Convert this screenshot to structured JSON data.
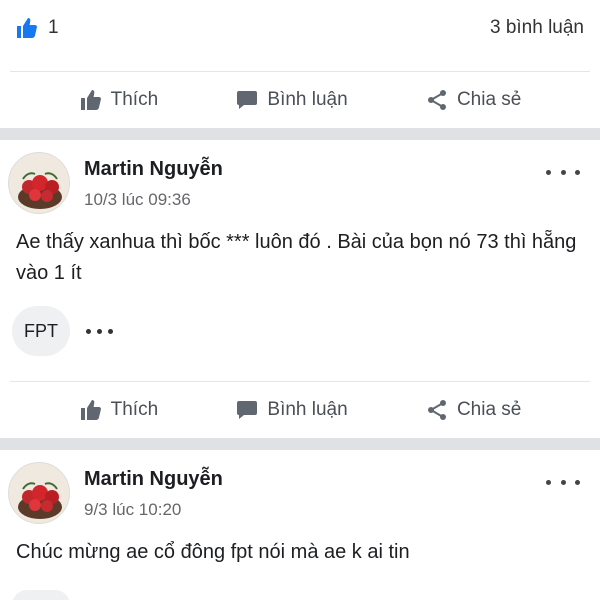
{
  "summary": {
    "reaction_count": "1",
    "comment_count": "3 bình luận"
  },
  "actions": {
    "like": "Thích",
    "comment": "Bình luận",
    "share": "Chia sẻ"
  },
  "posts": [
    {
      "author": "Martin Nguyễn",
      "timestamp": "10/3 lúc 09:36",
      "text": "Ae thấy xanhua thì bốc *** luôn đó . Bài của bọn nó 73 thì hẵng vào 1 ít",
      "tag": "FPT"
    },
    {
      "author": "Martin Nguyễn",
      "timestamp": "9/3 lúc 10:20",
      "text": "Chúc mừng ae cổ đông fpt nói mà ae k ai tin"
    }
  ],
  "colors": {
    "like_blue": "#1877f2",
    "separator_gray": "#dfe1e4",
    "secondary_text": "#65676b"
  }
}
